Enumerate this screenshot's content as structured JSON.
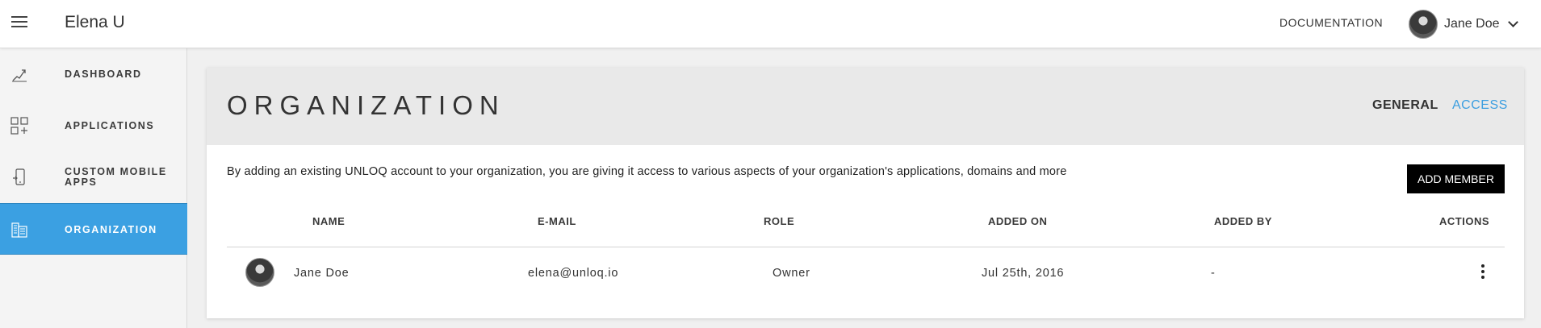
{
  "app": {
    "title": "Elena U"
  },
  "header": {
    "documentation_label": "DOCUMENTATION",
    "user_name": "Jane Doe"
  },
  "sidebar": {
    "items": [
      {
        "label": "DASHBOARD",
        "icon": "dashboard-icon"
      },
      {
        "label": "APPLICATIONS",
        "icon": "applications-icon"
      },
      {
        "label": "CUSTOM MOBILE APPS",
        "icon": "mobile-app-icon"
      },
      {
        "label": "ORGANIZATION",
        "icon": "organization-icon",
        "active": true
      }
    ]
  },
  "page": {
    "title": "ORGANIZATION",
    "tabs": [
      {
        "label": "GENERAL"
      },
      {
        "label": "ACCESS",
        "active": true
      }
    ],
    "description": "By adding an existing UNLOQ account to your organization, you are giving it access to various aspects of your organization's applications, domains and more",
    "add_member_label": "ADD MEMBER"
  },
  "table": {
    "columns": [
      "NAME",
      "E-MAIL",
      "ROLE",
      "ADDED ON",
      "ADDED BY",
      "ACTIONS"
    ],
    "rows": [
      {
        "name": "Jane Doe",
        "email": "elena@unloq.io",
        "role": "Owner",
        "added_on": "Jul 25th, 2016",
        "added_by": "-"
      }
    ]
  },
  "colors": {
    "accent": "#3ba0e2",
    "tab_active": "#3b9ee0",
    "button": "#000000"
  }
}
